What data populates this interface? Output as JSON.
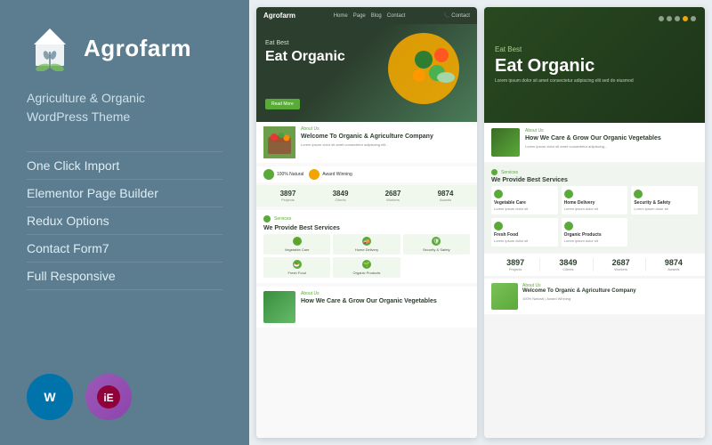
{
  "left": {
    "logo_text": "Agrofarm",
    "tagline_line1": "Agriculture & Organic",
    "tagline_line2": "WordPress Theme",
    "features": [
      "One Click Import",
      "Elementor Page Builder",
      "Redux Options",
      "Contact Form7",
      "Full Responsive"
    ],
    "badge_wp_label": "W",
    "badge_el_label": "E"
  },
  "preview1": {
    "brand": "Agrofarm",
    "nav_items": [
      "Home",
      "Page",
      "Blog",
      "Contact"
    ],
    "hero_small": "Eat Best",
    "hero_big": "Eat Organic",
    "hero_btn": "Read More",
    "welcome_tag": "About Us",
    "welcome_title": "Welcome To Organic & Agriculture Company",
    "icons": [
      "100% Natural",
      "Award Winning"
    ],
    "stats": [
      {
        "num": "3897",
        "label": ""
      },
      {
        "num": "3849",
        "label": ""
      },
      {
        "num": "2687",
        "label": ""
      },
      {
        "num": "9874",
        "label": ""
      }
    ],
    "services_tag": "Services",
    "services_title": "We Provide Best Services",
    "services": [
      "Vegetable Care",
      "Home Delivery",
      "Security & Safety",
      "Fresh Food",
      "Organic Products"
    ],
    "bio_tag": "About Us",
    "bio_title": "How We Care & Grow Our Organic Vegetables"
  },
  "preview2": {
    "hero_small": "Eat Best",
    "hero_big": "Eat Organic",
    "hero_desc": "Lorem ipsum dolor sit amet consectetur adipiscing elit sed do eiusmod",
    "dots": [
      "inactive",
      "inactive",
      "inactive",
      "active",
      "inactive"
    ],
    "bio_tag": "About Us",
    "bio_title": "How We Care & Grow Our Organic Vegetables",
    "services_tag": "Services",
    "services_title": "We Provide Best Services",
    "services": [
      "Vegetable Care",
      "Home Delivery",
      "Security & Safety",
      "Fresh Food",
      "Organic Products"
    ],
    "stats": [
      {
        "num": "3897"
      },
      {
        "num": "3849"
      },
      {
        "num": "2687"
      },
      {
        "num": "9874"
      }
    ],
    "welcome_tag": "About Us",
    "welcome_title": "Welcome To Organic & Agriculture Company",
    "welcome_sub": "100% Natural | Award Winning"
  }
}
